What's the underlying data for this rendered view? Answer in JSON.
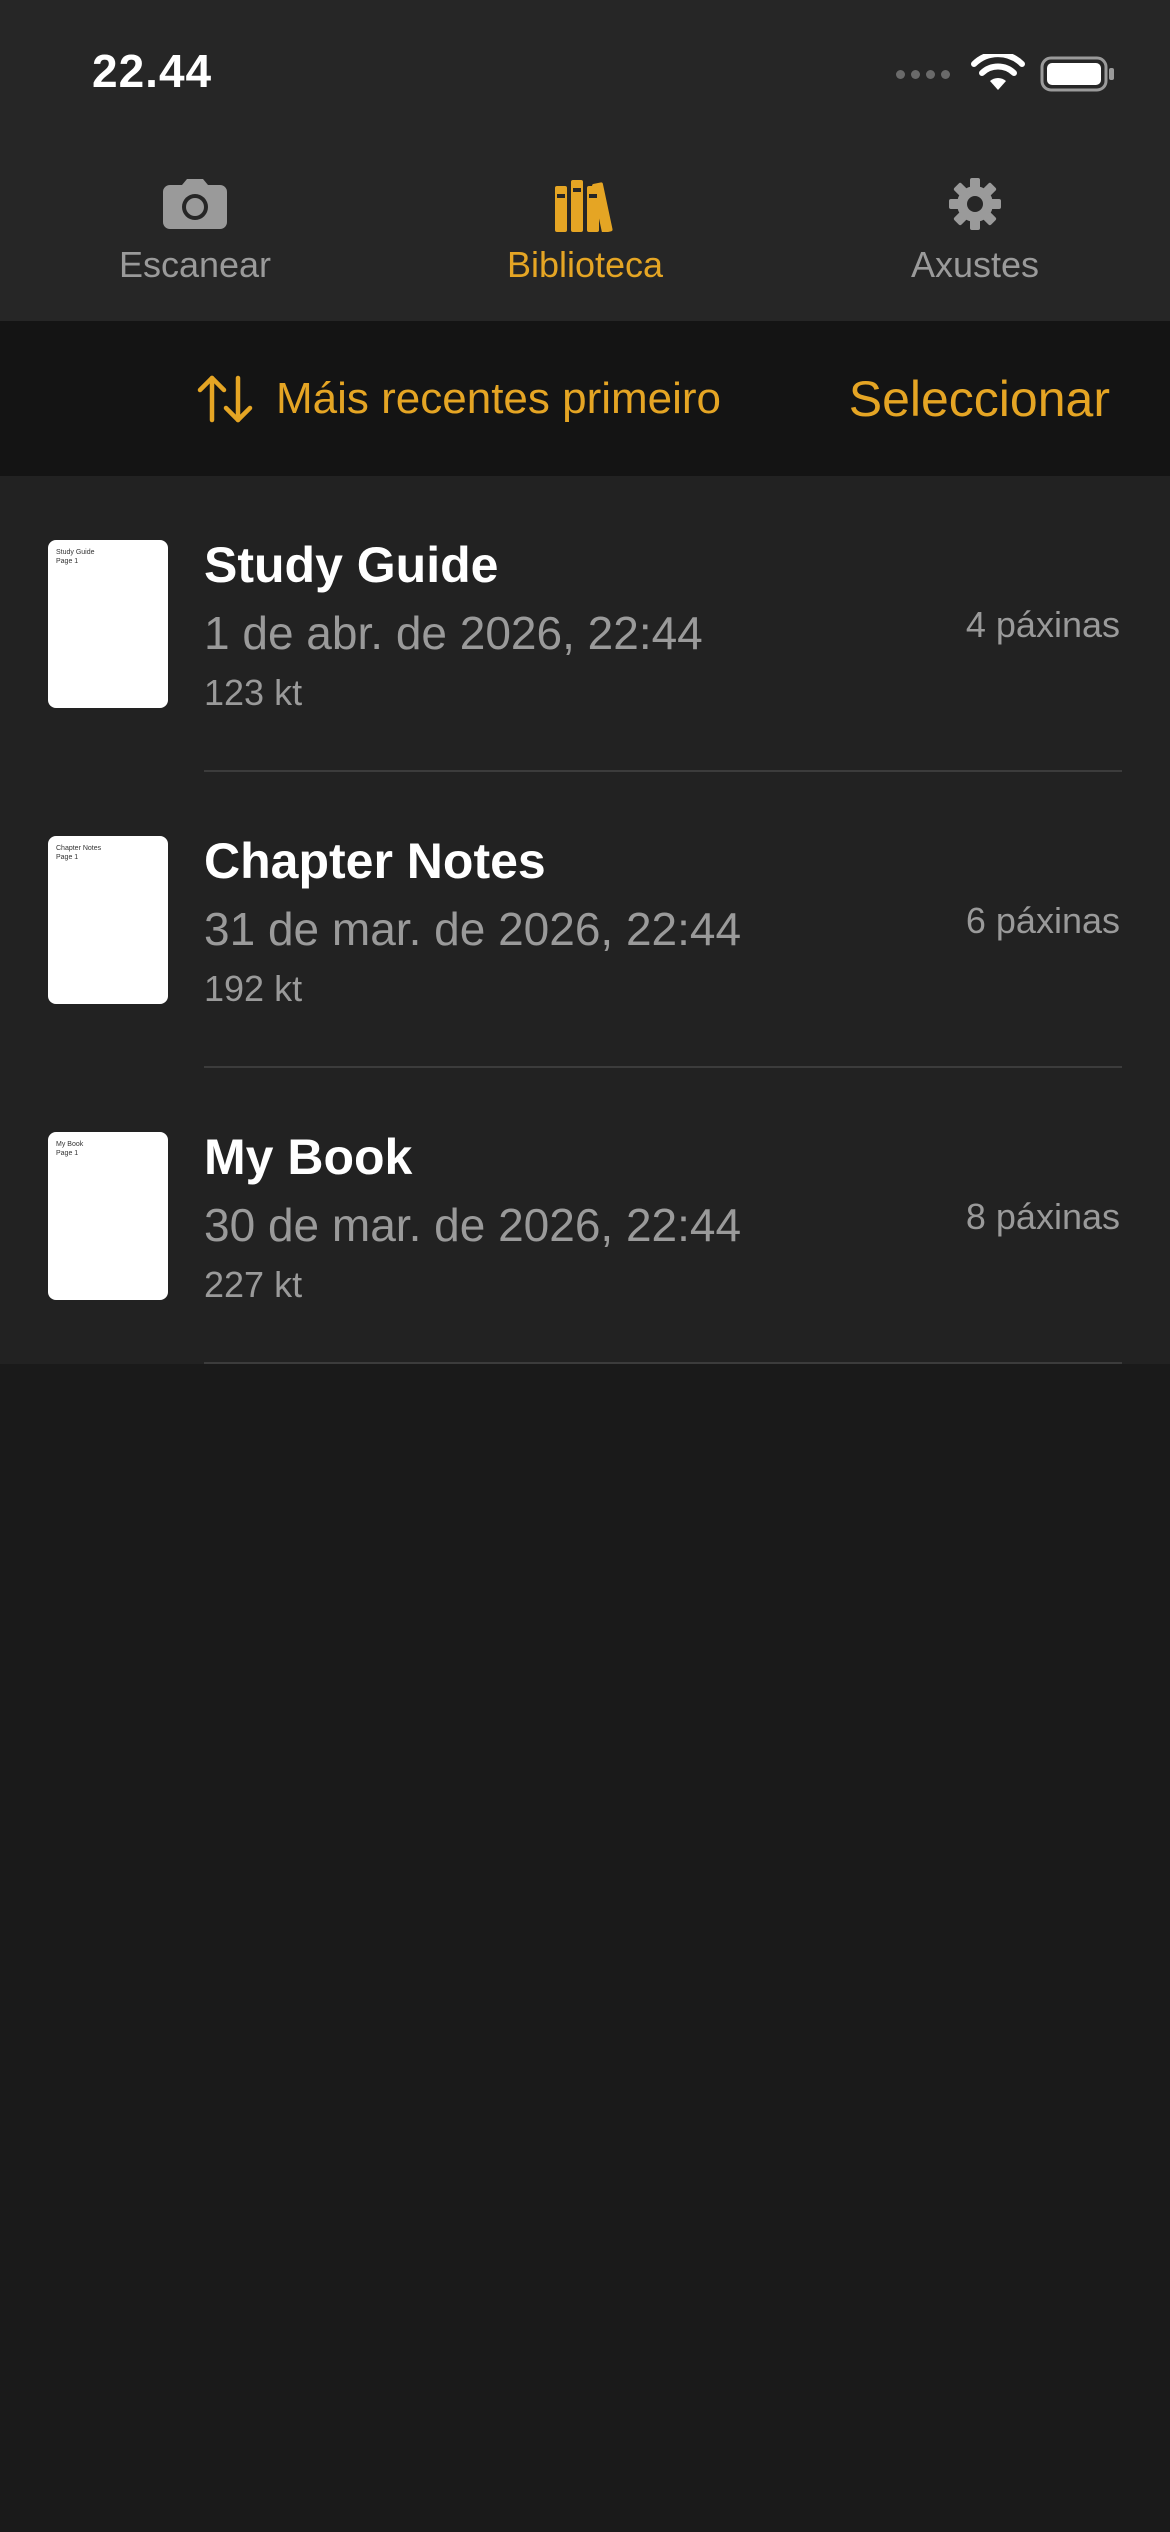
{
  "status_bar": {
    "time": "22.44"
  },
  "tabs": [
    {
      "label": "Escanear",
      "icon": "camera-icon",
      "active": false
    },
    {
      "label": "Biblioteca",
      "icon": "books-icon",
      "active": true
    },
    {
      "label": "Axustes",
      "icon": "gear-icon",
      "active": false
    }
  ],
  "toolbar": {
    "sort_label": "Máis recentes primeiro",
    "sort_icon": "sort-arrows-icon",
    "select_label": "Seleccionar"
  },
  "documents": [
    {
      "title": "Study Guide",
      "date": "1 de abr. de 2026, 22:44",
      "size": "123 kt",
      "pages": "4 páxinas",
      "thumb_text": "Study Guide\nPage 1"
    },
    {
      "title": "Chapter Notes",
      "date": "31 de mar. de 2026, 22:44",
      "size": "192 kt",
      "pages": "6 páxinas",
      "thumb_text": "Chapter Notes\nPage 1"
    },
    {
      "title": "My Book",
      "date": "30 de mar. de 2026, 22:44",
      "size": "227 kt",
      "pages": "8 páxinas",
      "thumb_text": "My Book\nPage 1"
    }
  ],
  "colors": {
    "accent": "#e5a524",
    "background": "#1a1a1a",
    "list_background": "#222222",
    "bar_background": "#262626",
    "secondary_text": "#9a9a9a"
  }
}
